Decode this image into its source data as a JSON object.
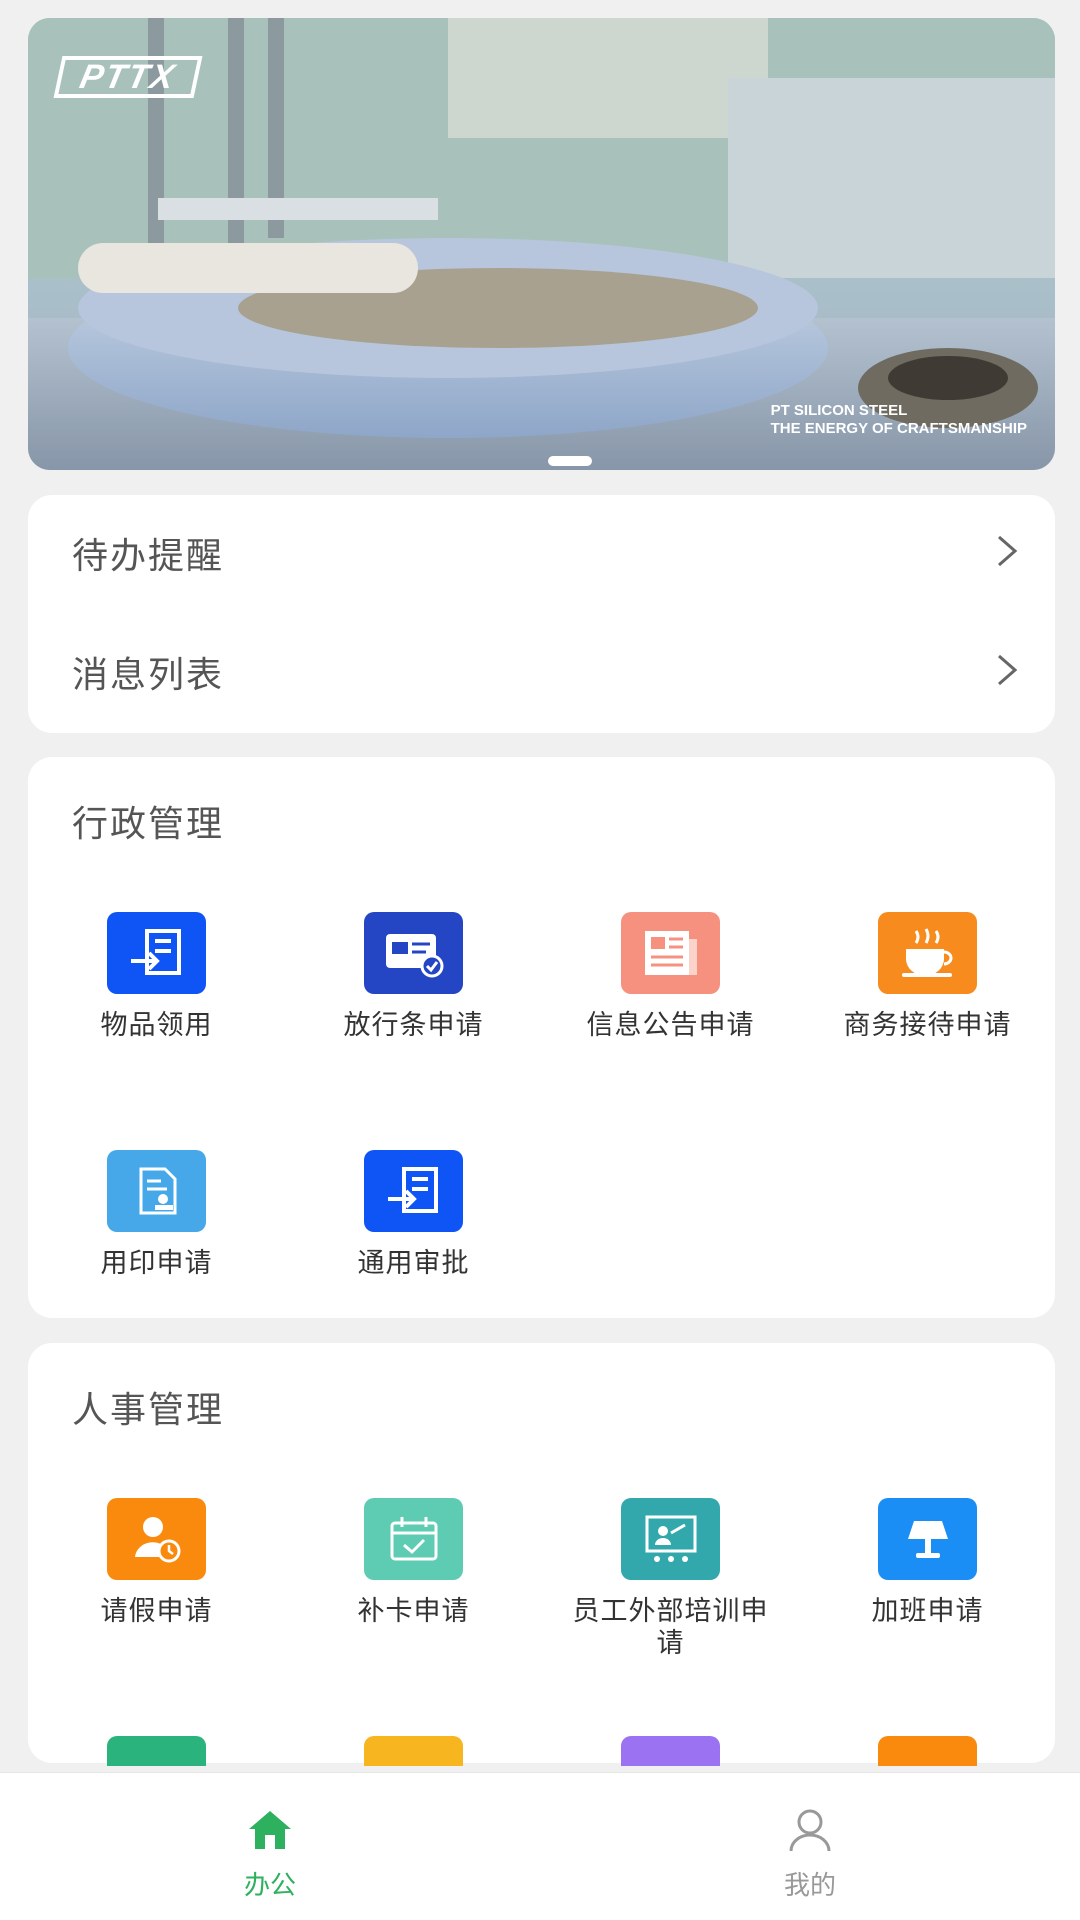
{
  "banner": {
    "logo_text": "PTTX",
    "caption_line1": "PT SILICON STEEL",
    "caption_line2": "THE ENERGY OF CRAFTSMANSHIP"
  },
  "reminders": [
    {
      "label": "待办提醒"
    },
    {
      "label": "消息列表"
    }
  ],
  "admin": {
    "title": "行政管理",
    "items": [
      {
        "label": "物品领用",
        "icon": "transfer-doc-icon",
        "color": "#0f54f5"
      },
      {
        "label": "放行条申请",
        "icon": "pass-card-icon",
        "color": "#2546c4"
      },
      {
        "label": "信息公告申请",
        "icon": "newspaper-icon",
        "color": "#f7917f"
      },
      {
        "label": "商务接待申请",
        "icon": "coffee-cup-icon",
        "color": "#f88b1e"
      },
      {
        "label": "用印申请",
        "icon": "seal-doc-icon",
        "color": "#46a8e8"
      },
      {
        "label": "通用审批",
        "icon": "transfer-doc-icon",
        "color": "#0f54f5"
      }
    ]
  },
  "hr": {
    "title": "人事管理",
    "items": [
      {
        "label": "请假申请",
        "icon": "user-clock-icon",
        "color": "#f98a0d"
      },
      {
        "label": "补卡申请",
        "icon": "calendar-check-icon",
        "color": "#5ecbb3"
      },
      {
        "label": "员工外部培训申请",
        "icon": "presentation-icon",
        "color": "#33a8ac"
      },
      {
        "label": "加班申请",
        "icon": "lamp-icon",
        "color": "#1a8ef5"
      }
    ],
    "partial_colors": [
      "#2bb37e",
      "#f7b520",
      "#9b73f2",
      "#f98a0d"
    ]
  },
  "nav": {
    "office_label": "办公",
    "mine_label": "我的",
    "active_color": "#2db15e",
    "inactive_color": "#999999"
  }
}
